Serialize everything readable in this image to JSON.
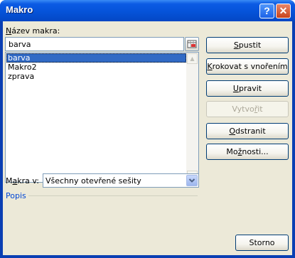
{
  "window": {
    "title": "Makro",
    "help_glyph": "?",
    "close_glyph": "✕"
  },
  "macro_name": {
    "label_u": "N",
    "label_rest": "ázev makra:",
    "value": "barva"
  },
  "macro_list": {
    "items": [
      "barva",
      "Makro2",
      "zprava"
    ],
    "selected_index": 0
  },
  "buttons": {
    "run": {
      "u": "S",
      "rest": "pustit"
    },
    "step": {
      "pre": "",
      "u": "K",
      "rest": "rokovat s vnořením"
    },
    "edit": {
      "u": "U",
      "rest": "pravit"
    },
    "create": {
      "pre": "Vytvo",
      "u": "ř",
      "rest": "it"
    },
    "delete": {
      "u": "O",
      "rest": "dstranit"
    },
    "options": {
      "pre": "Mo",
      "u": "ž",
      "rest": "nosti..."
    },
    "cancel": "Storno"
  },
  "macros_in": {
    "label_pre": "M",
    "label_u": "a",
    "label_rest": "kra v:",
    "value": "Všechny otevřené sešity"
  },
  "description": {
    "label": "Popis"
  },
  "scroll": {
    "up": "▲",
    "down": "▼"
  }
}
